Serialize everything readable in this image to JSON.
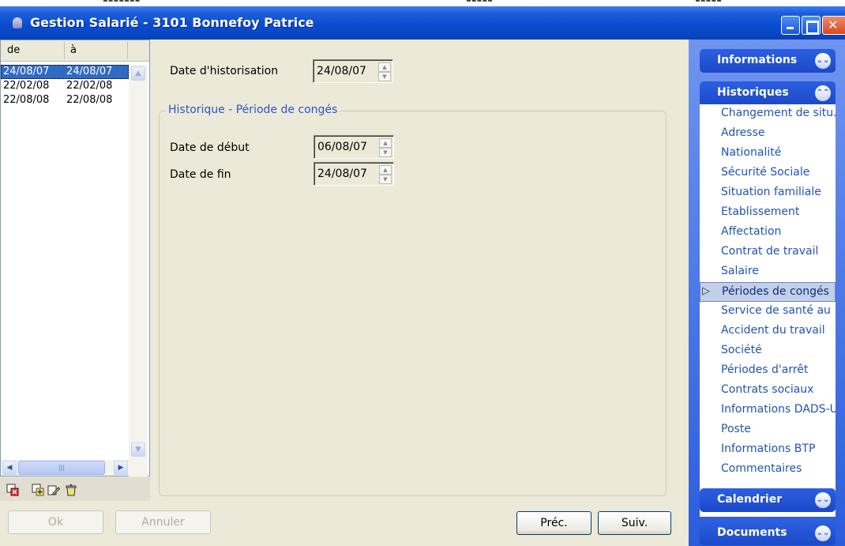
{
  "window": {
    "title": "Gestion Salarié - 3101 Bonnefoy Patrice"
  },
  "history_list": {
    "col_from": "de",
    "col_to": "à",
    "rows": [
      {
        "from": "24/08/07",
        "to": "24/08/07",
        "selected": true
      },
      {
        "from": "22/02/08",
        "to": "22/02/08",
        "selected": false
      },
      {
        "from": "22/08/08",
        "to": "22/08/08",
        "selected": false
      }
    ],
    "hscroll_grip": "|||"
  },
  "form": {
    "hist_date_label": "Date d'historisation",
    "hist_date_value": "24/08/07",
    "group_title": "Historique - Période de congés",
    "start_label": "Date de début",
    "start_value": "06/08/07",
    "end_label": "Date de fin",
    "end_value": "24/08/07"
  },
  "buttons": {
    "ok": "Ok",
    "cancel": "Annuler",
    "prev": "Préc.",
    "next": "Suiv."
  },
  "nav": {
    "informations": "Informations",
    "historiques": "Historiques",
    "calendrier": "Calendrier",
    "documents": "Documents",
    "items": [
      "Changement de situ...",
      "Adresse",
      "Nationalité",
      "Sécurité Sociale",
      "Situation familiale",
      "Etablissement",
      "Affectation",
      "Contrat de travail",
      "Salaire",
      "Périodes de congés",
      "Service de santé au ...",
      "Accident du travail",
      "Société",
      "Périodes d'arrêt",
      "Contrats sociaux",
      "Informations DADS-U",
      "Poste",
      "Informations BTP",
      "Commentaires"
    ],
    "active_index": 9
  },
  "colors": {
    "titlebar": "#0a4cd0",
    "selection": "#316ac5",
    "nav_link": "#2152b8",
    "group_title": "#2856c8"
  }
}
